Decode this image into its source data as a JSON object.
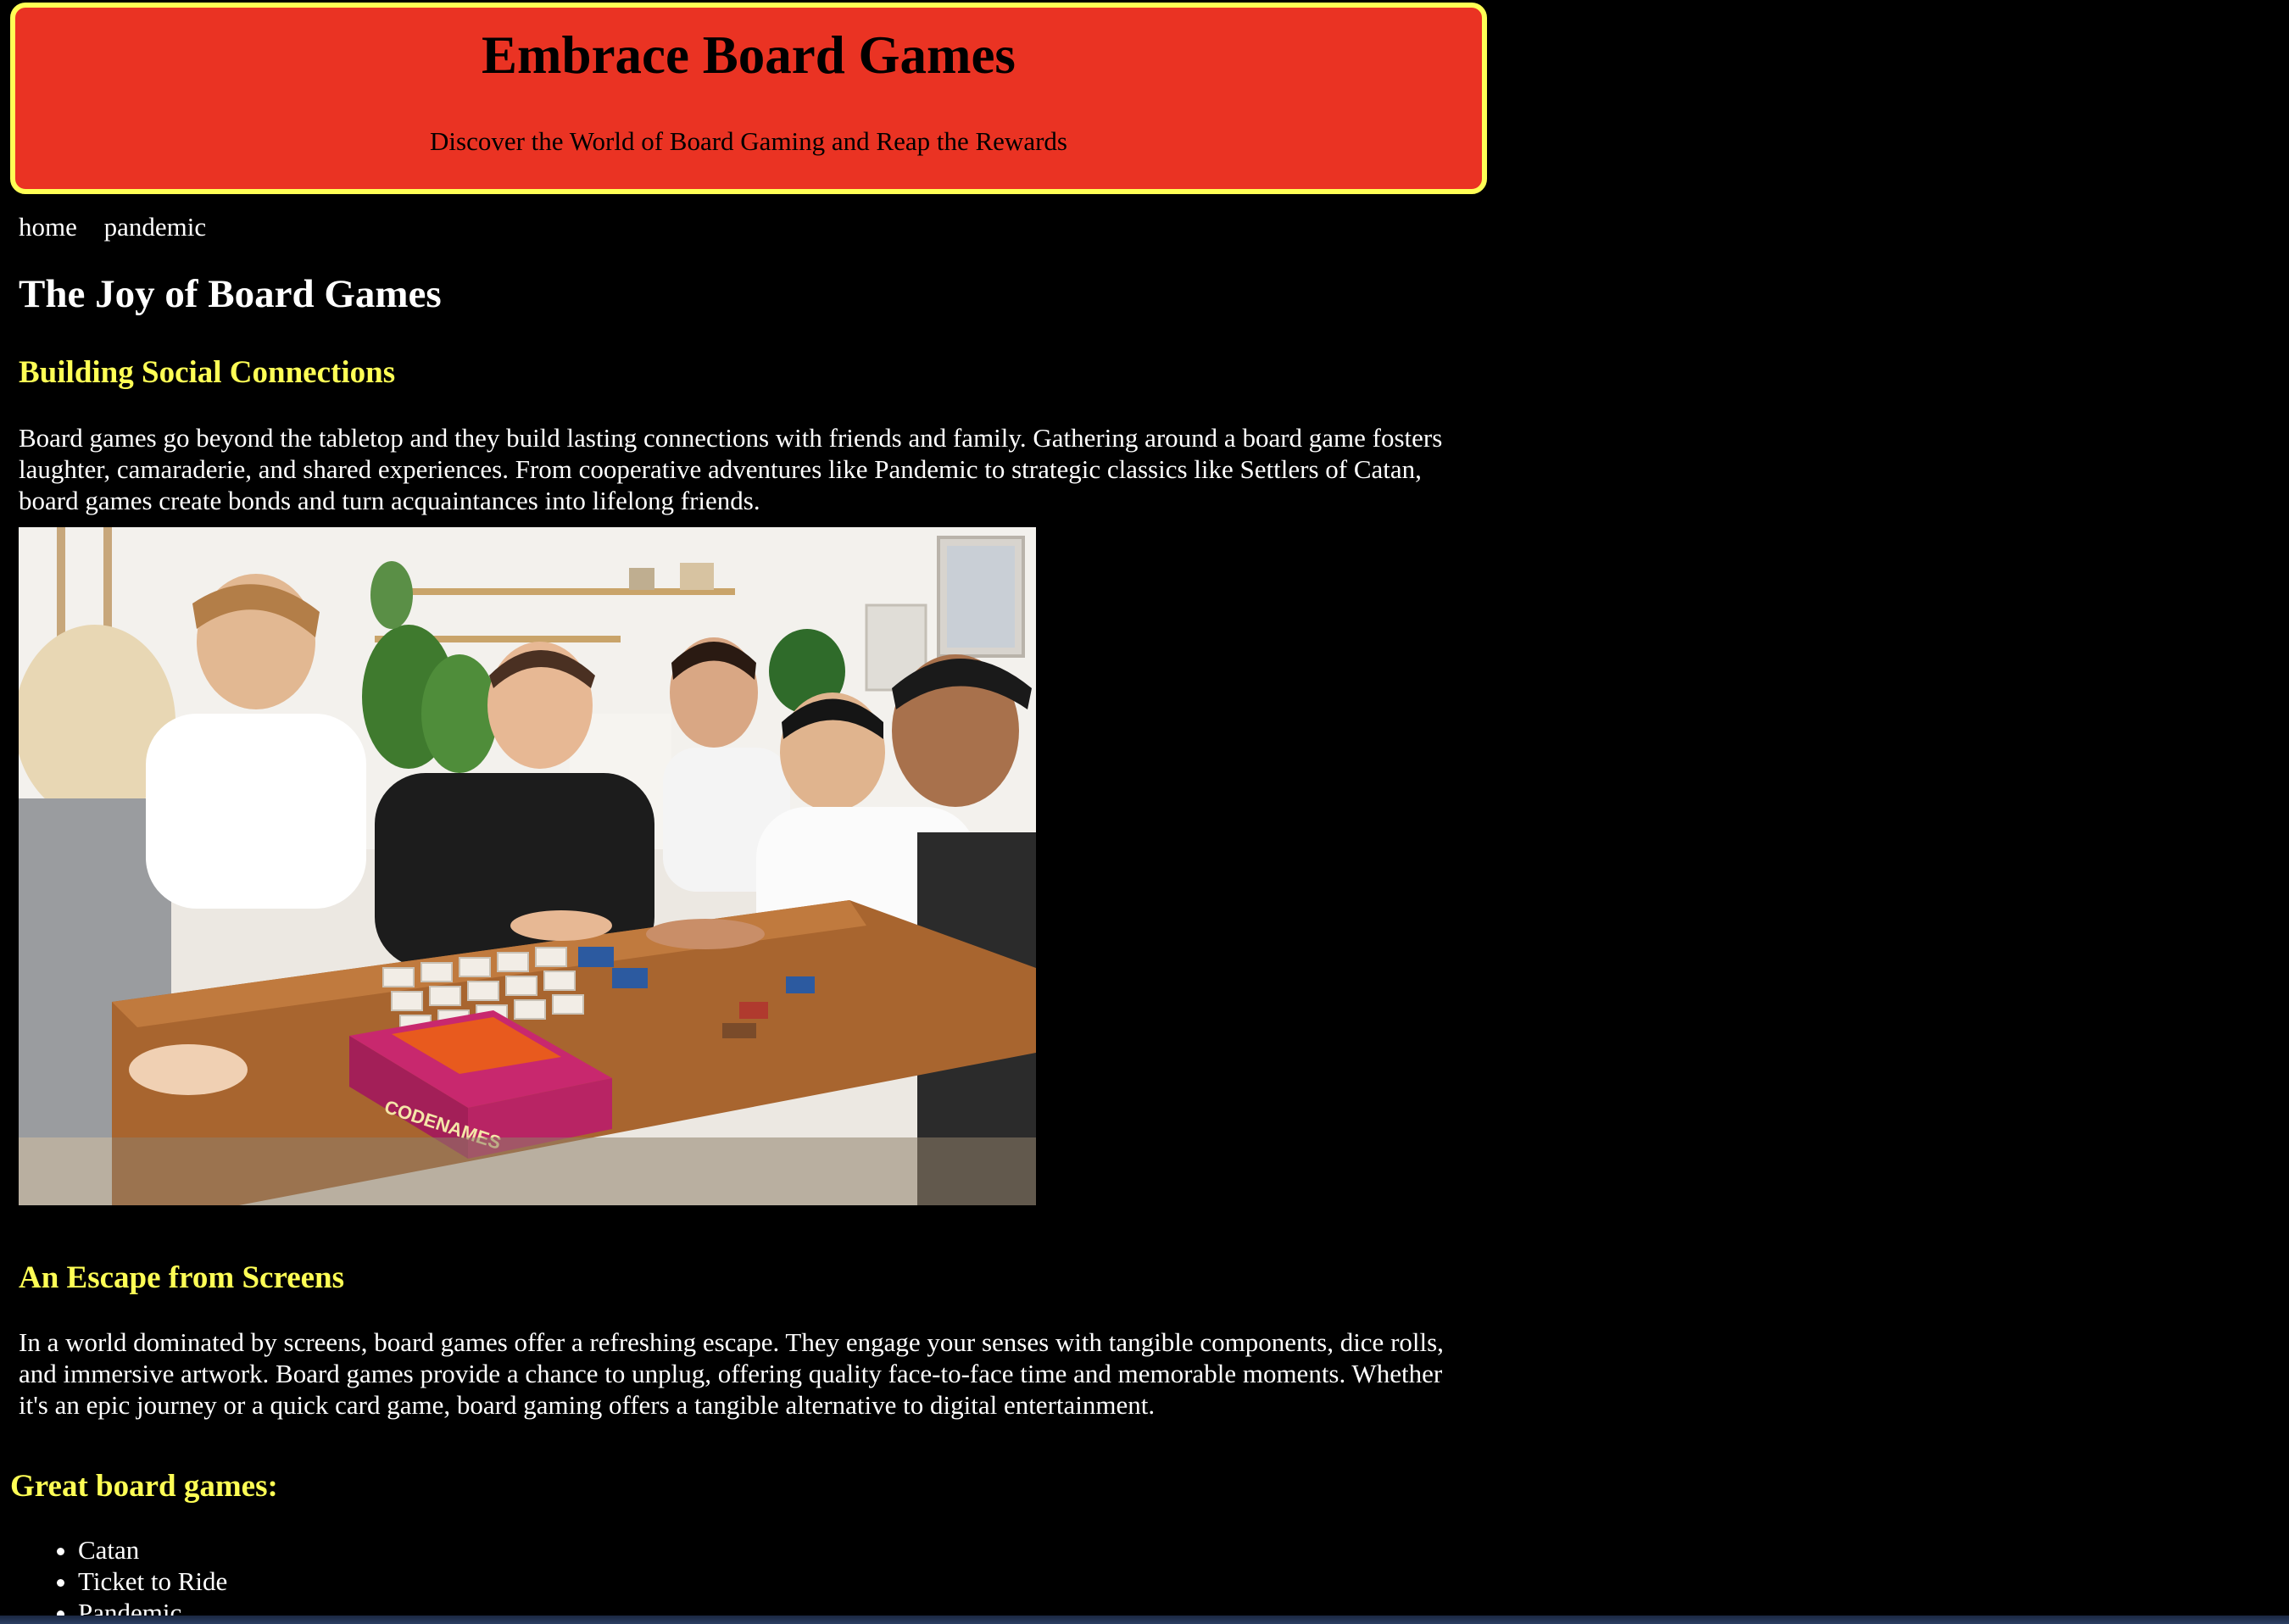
{
  "header": {
    "title": "Embrace Board Games",
    "tagline": "Discover the World of Board Gaming and Reap the Rewards"
  },
  "nav": {
    "items": [
      {
        "label": "home"
      },
      {
        "label": "pandemic"
      }
    ]
  },
  "main": {
    "title": "The Joy of Board Games",
    "sections": [
      {
        "heading": "Building Social Connections",
        "body": "Board games go beyond the tabletop and they build lasting connections with friends and family. Gathering around a board game fosters laughter, camaraderie, and shared experiences. From cooperative adventures like Pandemic to strategic classics like Settlers of Catan, board games create bonds and turn acquaintances into lifelong friends."
      },
      {
        "heading": "An Escape from Screens",
        "body": "In a world dominated by screens, board games offer a refreshing escape. They engage your senses with tangible components, dice rolls, and immersive artwork. Board games provide a chance to unplug, offering quality face-to-face time and memorable moments. Whether it's an epic journey or a quick card game, board gaming offers a tangible alternative to digital entertainment."
      }
    ],
    "photo_box_text": "CODENAMES"
  },
  "list": {
    "heading": "Great board games:",
    "items": [
      "Catan",
      "Ticket to Ride",
      "Pandemic"
    ]
  },
  "colors": {
    "header_bg": "#ea3323",
    "header_border": "#ffff55",
    "heading_accent": "#ffff55",
    "page_bg": "#000000"
  }
}
